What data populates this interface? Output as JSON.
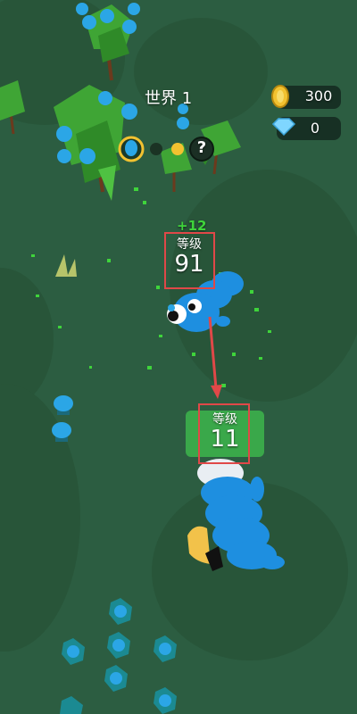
{
  "hud": {
    "world_label": "世界 1",
    "coins": "300",
    "gems": "0",
    "mystery_symbol": "?"
  },
  "xp_popup": "+12",
  "player": {
    "level_caption": "等级",
    "level": "91"
  },
  "target": {
    "level_caption": "等级",
    "level": "11"
  },
  "icons": {
    "coin": "coin-icon",
    "gem": "diamond-icon",
    "egg": "egg-icon",
    "mystery": "question-icon"
  },
  "colors": {
    "ground": "#2c5d41",
    "worm": "#1e8fe0",
    "highlight_outline": "#e04848",
    "target_badge": "#3aa84a",
    "coin": "#f2c230",
    "gem": "#7fd6ff"
  }
}
